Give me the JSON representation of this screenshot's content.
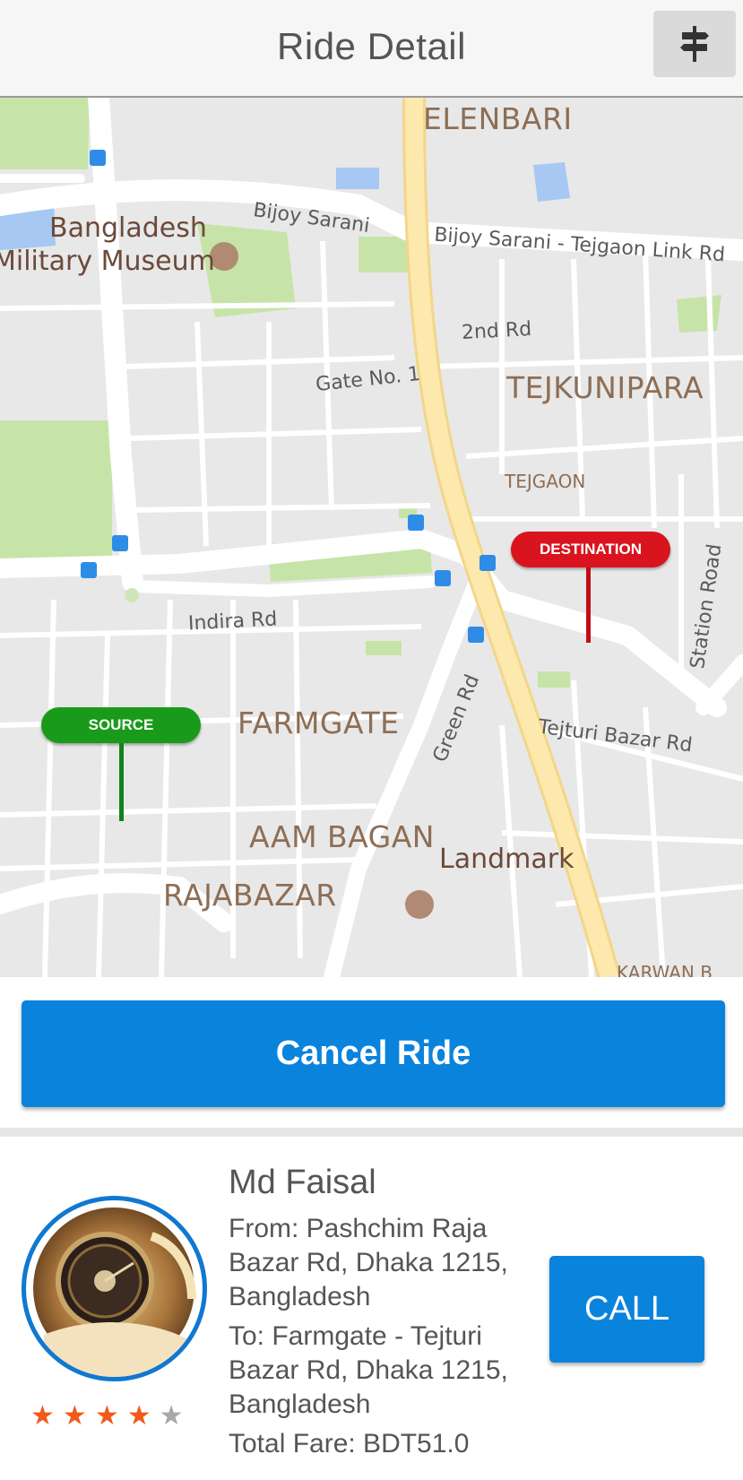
{
  "header": {
    "title": "Ride Detail",
    "action_icon": "signpost-icon"
  },
  "map": {
    "areas": [
      "ELENBARI",
      "TEJKUNIPARA",
      "FARMGATE",
      "AAM BAGAN",
      "RAJABAZAR"
    ],
    "roads": [
      "Bijoy Sarani",
      "Bijoy Sarani - Tejgaon Link Rd",
      "2nd Rd",
      "Gate No. 1",
      "Indira Rd",
      "Green Rd",
      "Tejturi Bazar Rd",
      "Station Road"
    ],
    "places": [
      "Bangladesh",
      "Military Museum",
      "TEJGAON",
      "Landmark",
      "KARWAN B"
    ],
    "markers": {
      "source": "SOURCE",
      "destination": "DESTINATION"
    },
    "colors": {
      "source": "#1a9a1a",
      "destination": "#d9141e",
      "highway": "#fbe6a3"
    }
  },
  "actions": {
    "cancel_label": "Cancel Ride",
    "call_label": "CALL"
  },
  "driver": {
    "name": "Md Faisal",
    "from": "From: Pashchim Raja Bazar Rd, Dhaka 1215, Bangladesh",
    "to": "To: Farmgate - Tejturi Bazar Rd, Dhaka 1215, Bangladesh",
    "fare": "Total Fare: BDT51.0",
    "rating": 4,
    "rating_max": 5
  }
}
